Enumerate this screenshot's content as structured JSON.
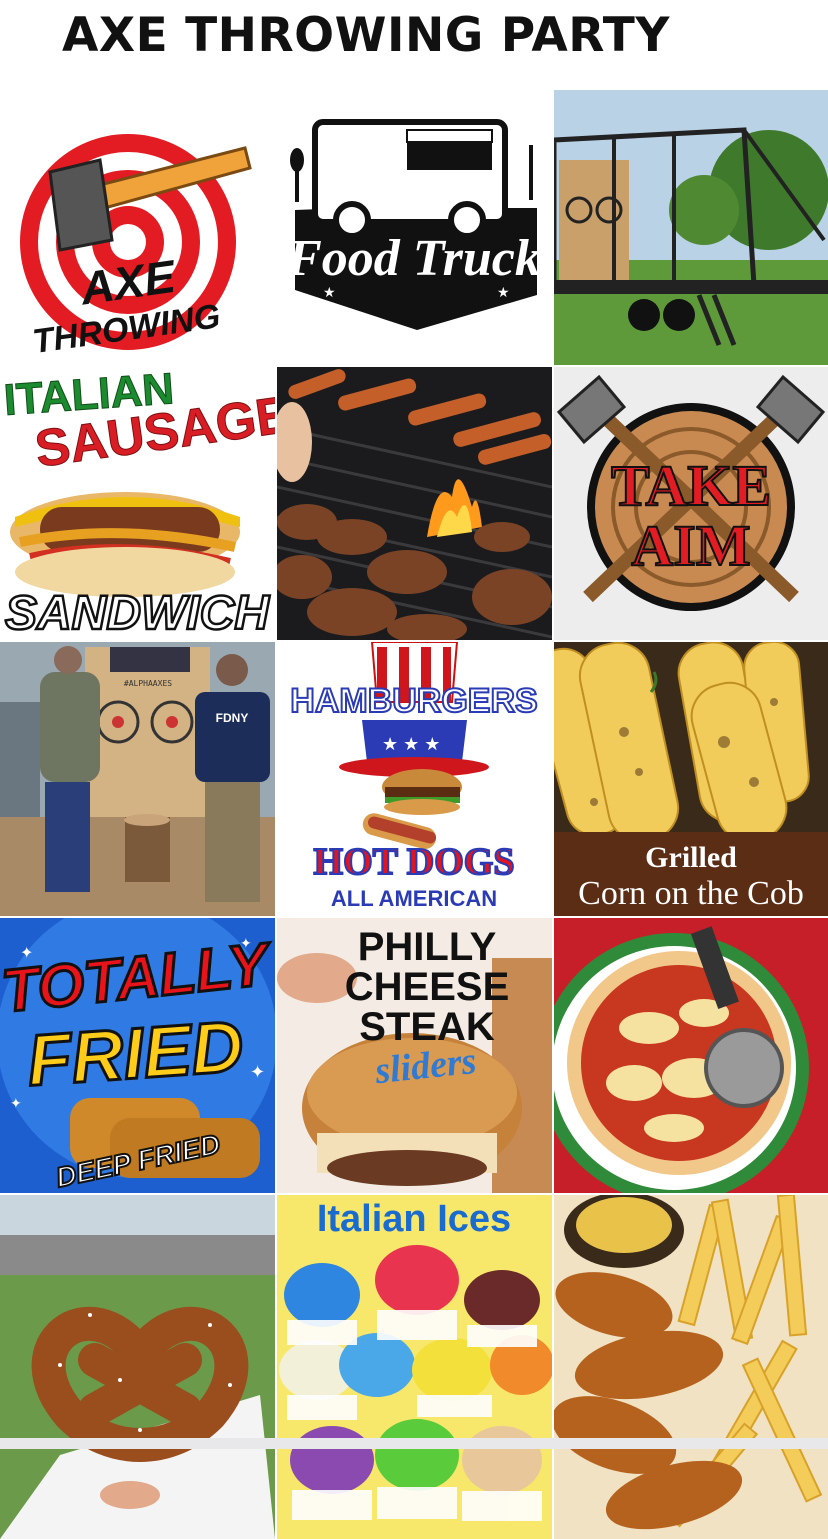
{
  "page": {
    "title": "AXE THROWING PARTY"
  },
  "tiles": {
    "axe_throwing": {
      "line1": "AXE",
      "line2": "THROWING"
    },
    "food_truck": {
      "label": "Food Truck"
    },
    "trailer": {},
    "sausage": {
      "line1": "ITALIAN",
      "line2": "SAUSAGE",
      "line3": "SANDWICH"
    },
    "grill": {},
    "take_aim": {
      "line1": "TAKE",
      "line2": "AIM"
    },
    "throwers": {
      "jacket": "FDNY",
      "sign": "#ALPHAAXES"
    },
    "hamburgers": {
      "line1": "HAMBURGERS",
      "line2": "HOT DOGS",
      "line3": "ALL AMERICAN"
    },
    "corn": {
      "line1": "Grilled",
      "line2": "Corn on the Cob"
    },
    "totally_fried": {
      "line1": "TOTALLY",
      "line2": "FRIED",
      "line3": "DEEP FRIED"
    },
    "philly": {
      "line1": "PHILLY",
      "line2": "CHEESE",
      "line3": "STEAK",
      "line4": "sliders"
    },
    "pizza": {},
    "pretzel": {},
    "italian_ices": {
      "label": "Italian Ices"
    },
    "chicken_fries": {}
  }
}
